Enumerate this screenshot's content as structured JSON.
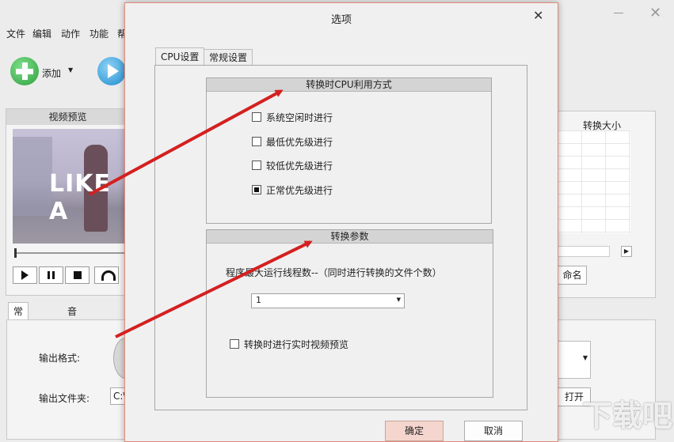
{
  "app": {
    "menu": [
      "文件",
      "编辑",
      "动作",
      "功能",
      "帮"
    ],
    "toolbar": {
      "add_label": "添加"
    },
    "preview_title": "视频预览",
    "video_overlay": "LIKE A",
    "list_header": "转换大小",
    "rename_label": "命名",
    "tabs": [
      "常规设置",
      "音视频高级设"
    ],
    "output_format_label": "输出格式:",
    "output_folder_label": "输出文件夹:",
    "output_folder_value": "C:\\",
    "open_label": "打开",
    "watermark": "下载吧"
  },
  "dialog": {
    "title": "选项",
    "tabs": [
      "CPU设置",
      "常规设置"
    ],
    "cpu_group": {
      "title": "转换时CPU利用方式",
      "options": [
        {
          "label": "系统空闲时进行",
          "checked": false
        },
        {
          "label": "最低优先级进行",
          "checked": false
        },
        {
          "label": "较低优先级进行",
          "checked": false
        },
        {
          "label": "正常优先级进行",
          "checked": true
        }
      ]
    },
    "param_group": {
      "title": "转换参数",
      "thread_label": "程序最大运行线程数--（同时进行转换的文件个数）",
      "thread_value": "1",
      "preview_label": "转换时进行实时视频预览",
      "preview_checked": false
    },
    "ok_label": "确定",
    "cancel_label": "取消"
  },
  "colors": {
    "arrow": "#d42020",
    "ok_bg": "#f5d6cf",
    "accent_green": "#3bb04b",
    "accent_blue": "#2a9ad8"
  }
}
